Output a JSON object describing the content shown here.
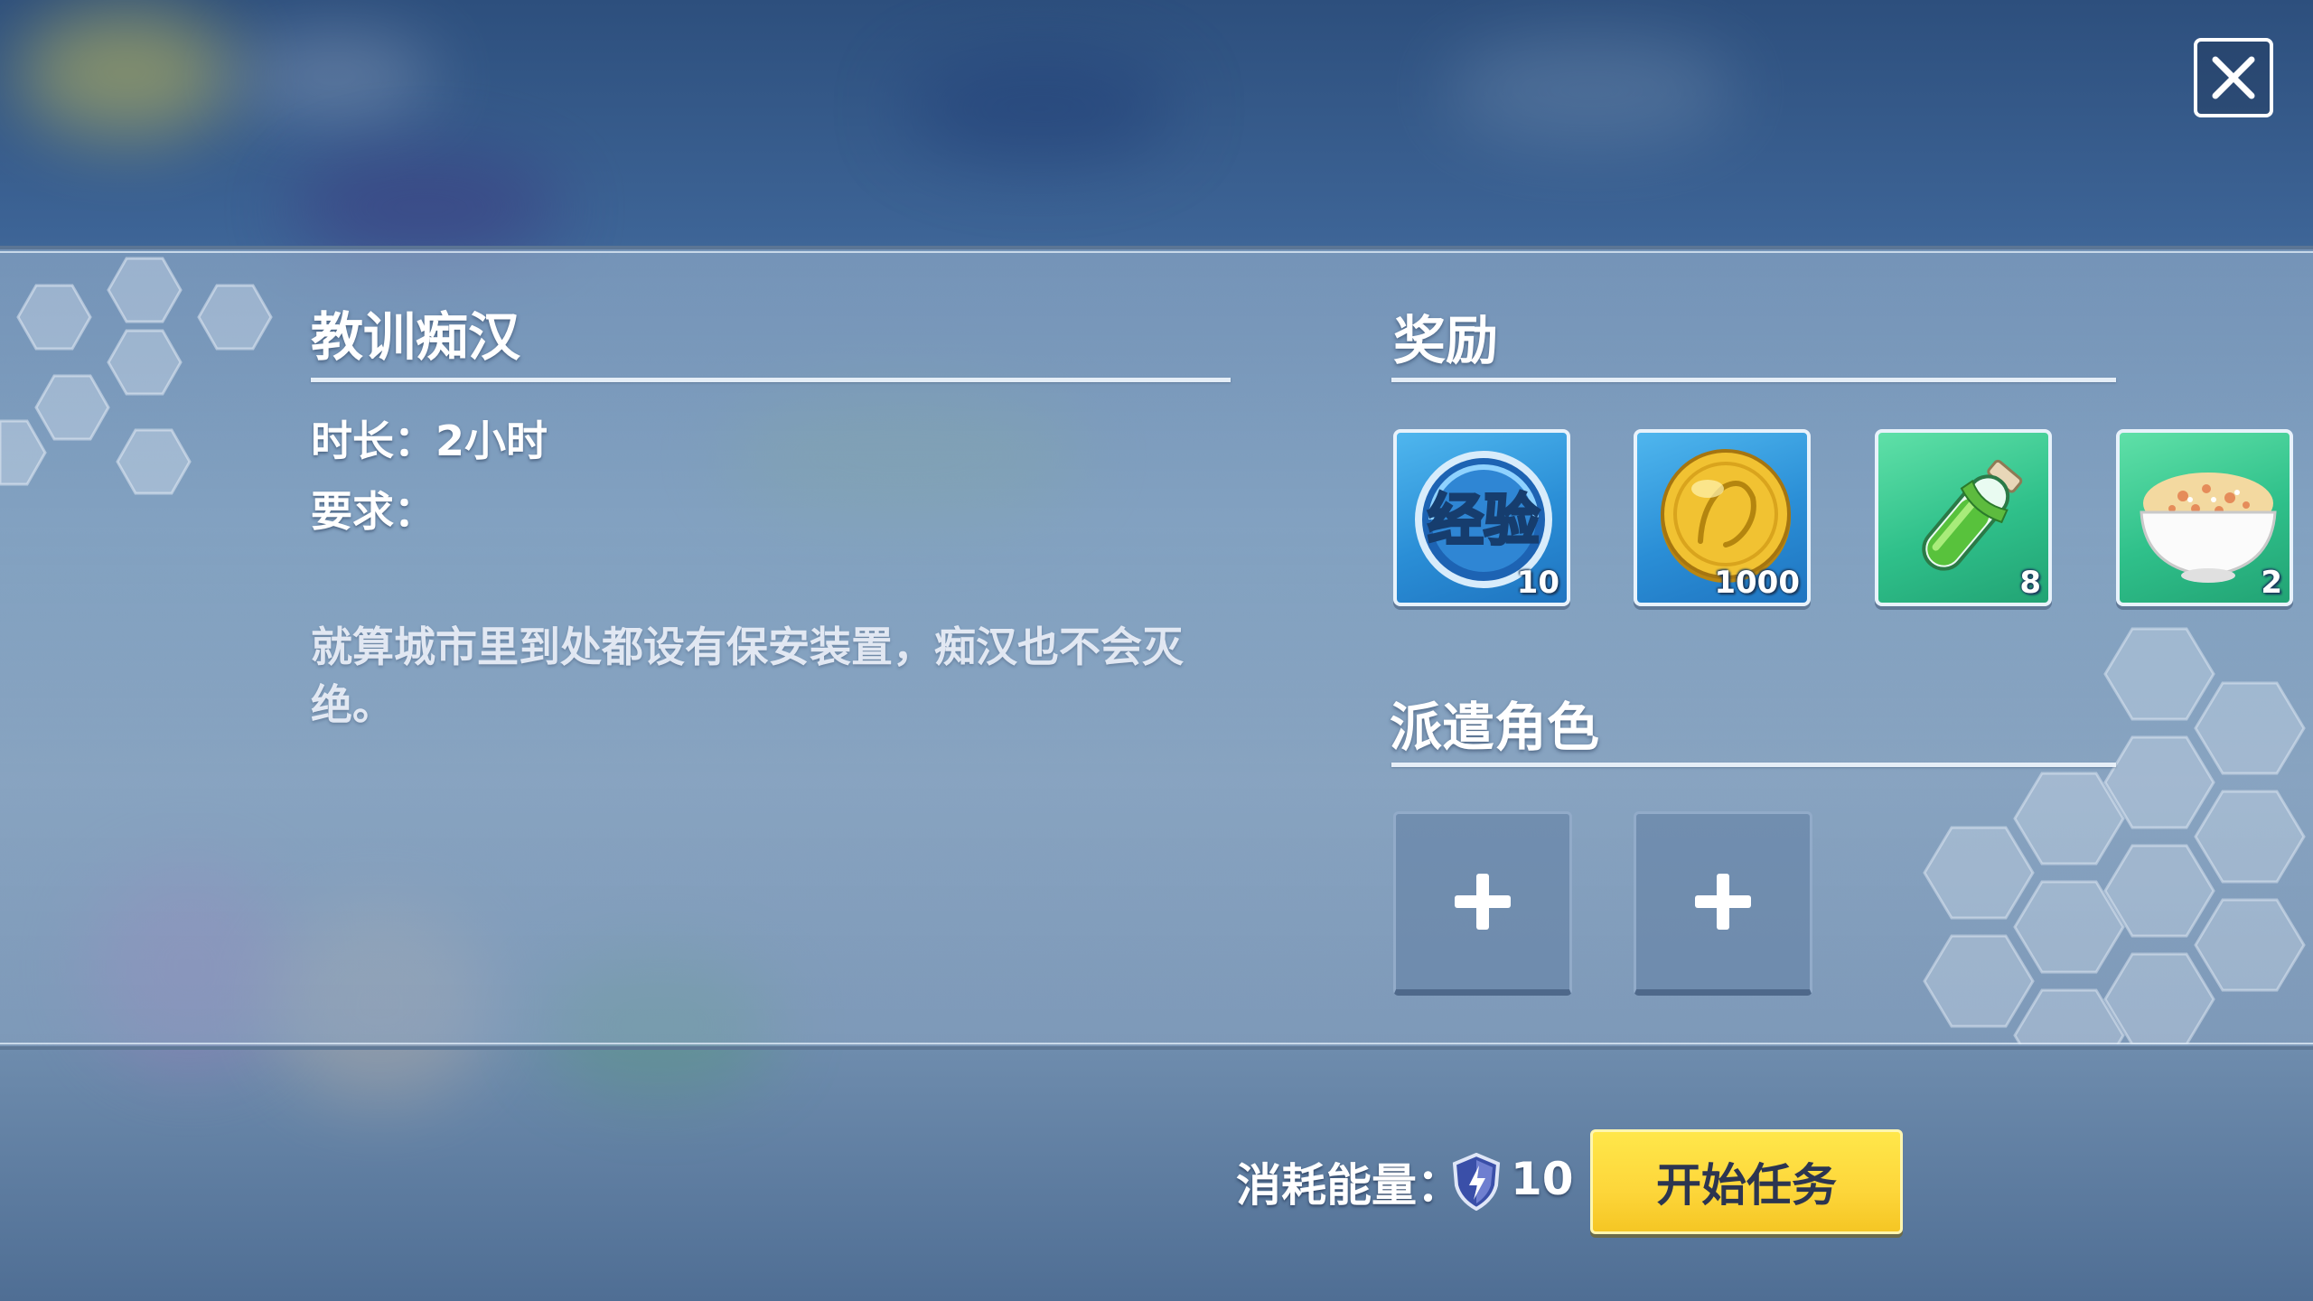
{
  "mission": {
    "title": "教训痴汉",
    "duration_label": "时长：",
    "duration_value": "2小时",
    "requirement_label": "要求：",
    "description": "就算城市里到处都设有保安装置，痴汉也不会灭绝。"
  },
  "rewards": {
    "heading": "奖励",
    "items": [
      {
        "icon": "exp-icon",
        "label": "经验",
        "count": "10"
      },
      {
        "icon": "gold-coin-icon",
        "count": "1000"
      },
      {
        "icon": "potion-tube-icon",
        "count": "8"
      },
      {
        "icon": "rice-bowl-icon",
        "count": "2"
      }
    ]
  },
  "dispatch": {
    "heading": "派遣角色",
    "slots": [
      "+",
      "+"
    ]
  },
  "footer": {
    "cost_label": "消耗能量：",
    "cost_value": "10",
    "start_label": "开始任务"
  },
  "colors": {
    "button_yellow": "#fdd63a",
    "reward_blue": "#2a8ed6",
    "reward_green": "#2fc08a"
  }
}
